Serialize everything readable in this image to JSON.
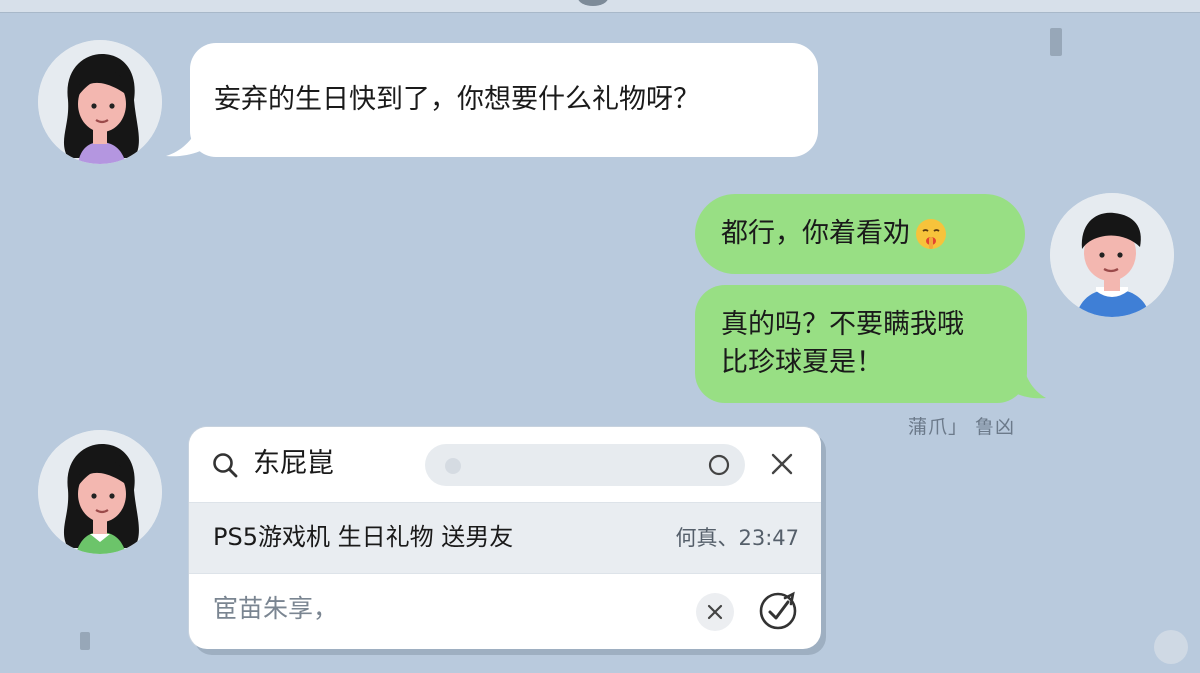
{
  "messages": {
    "incoming": "妄弃的生日快到了，你想要什么礼物呀？",
    "outgoing_1": "都行，你着看劝",
    "outgoing_2_line1": "真的吗？不要瞒我哦",
    "outgoing_2_line2": "比珍球夏是！",
    "outgoing_meta": "蒲爪」 鲁凶"
  },
  "search_card": {
    "title": "东屁崑",
    "result_text": "PS5游戏机 生日礼物 送男友",
    "result_time": "何真、23:47",
    "input_placeholder": "宦苗朱享，"
  },
  "icons": {
    "emoji": "shushing-face-emoji",
    "search": "search-icon",
    "close": "close-icon",
    "clear": "clear-icon",
    "send": "send-icon"
  },
  "colors": {
    "background": "#b9cadd",
    "incoming_bubble": "#ffffff",
    "outgoing_bubble": "#98df84"
  }
}
